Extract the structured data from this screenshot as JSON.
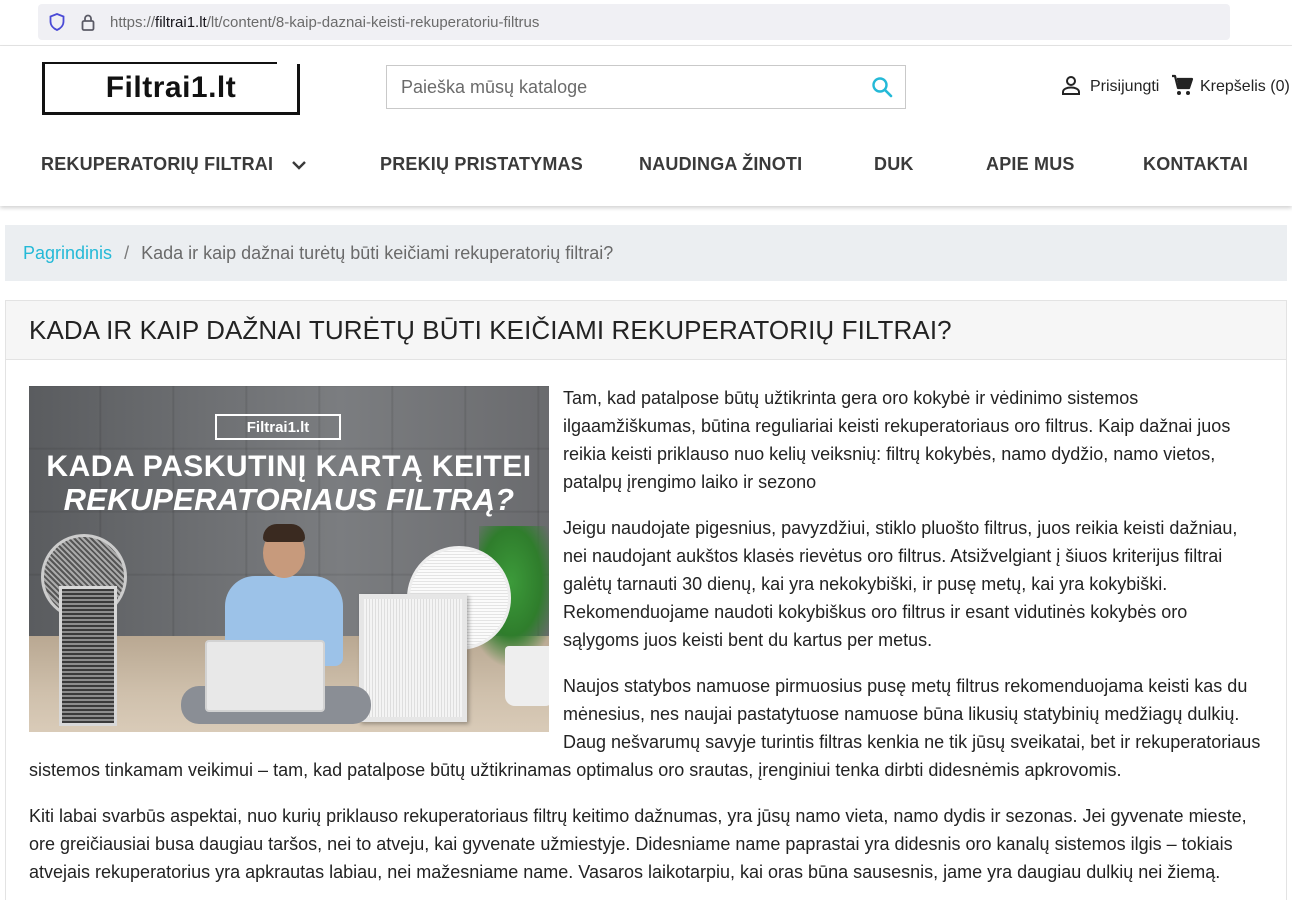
{
  "browser": {
    "url_prefix": "https://",
    "url_domain": "filtrai1.lt",
    "url_path": "/lt/content/8-kaip-daznai-keisti-rekuperatoriu-filtrus"
  },
  "header": {
    "logo_text": "Filtrai1.lt",
    "search_placeholder": "Paieška mūsų kataloge",
    "account_label": "Prisijungti",
    "cart_label": "Krepšelis",
    "cart_count": "(0)"
  },
  "nav": {
    "items": [
      {
        "label": "REKUPERATORIŲ FILTRAI",
        "has_dropdown": true
      },
      {
        "label": "PREKIŲ PRISTATYMAS"
      },
      {
        "label": "NAUDINGA ŽINOTI"
      },
      {
        "label": "DUK"
      },
      {
        "label": "APIE MUS"
      },
      {
        "label": "KONTAKTAI"
      }
    ]
  },
  "breadcrumb": {
    "home": "Pagrindinis",
    "separator": "/",
    "current": "Kada ir kaip dažnai turėtų būti keičiami rekuperatorių filtrai?"
  },
  "article": {
    "title": "KADA IR KAIP DAŽNAI TURĖTŲ BŪTI KEIČIAMI REKUPERATORIŲ FILTRAI?",
    "image": {
      "badge": "Filtrai1.lt",
      "line1": "KADA PASKUTINĮ KARTĄ KEITEI",
      "line2": "REKUPERATORIAUS FILTRĄ?"
    },
    "paragraphs": [
      "Tam, kad patalpose būtų užtikrinta gera oro kokybė ir vėdinimo sistemos ilgaamžiškumas, būtina reguliariai keisti rekuperatoriaus oro filtrus. Kaip dažnai juos reikia keisti priklauso nuo kelių veiksnių: filtrų kokybės, namo dydžio, namo vietos, patalpų įrengimo laiko ir sezono",
      "Jeigu naudojate pigesnius, pavyzdžiui, stiklo pluošto filtrus, juos reikia keisti dažniau, nei naudojant aukštos klasės rievėtus oro filtrus. Atsižvelgiant į šiuos kriterijus filtrai galėtų tarnauti 30 dienų, kai yra nekokybiški, ir pusę metų, kai yra kokybiški. Rekomenduojame naudoti kokybiškus oro filtrus ir esant vidutinės kokybės oro sąlygoms juos keisti bent du kartus per metus.",
      "Naujos statybos namuose pirmuosius pusę metų filtrus rekomenduojama keisti kas du mėnesius, nes naujai pastatytuose namuose būna likusių statybinių medžiagų dulkių. Daug nešvarumų savyje turintis filtras kenkia ne tik jūsų sveikatai, bet ir rekuperatoriaus sistemos tinkamam veikimui – tam, kad patalpose būtų užtikrinamas optimalus oro srautas, įrenginiui tenka dirbti didesnėmis apkrovomis.",
      "Kiti labai svarbūs aspektai, nuo kurių priklauso rekuperatoriaus filtrų keitimo dažnumas, yra jūsų namo vieta, namo dydis ir sezonas. Jei gyvenate mieste, ore greičiausiai busa daugiau taršos, nei to atveju, kai gyvenate užmiestyje. Didesniame name paprastai yra didesnis oro kanalų sistemos ilgis – tokiais atvejais rekuperatorius yra apkrautas labiau, nei mažesniame name. Vasaros laikotarpiu, kai oras būna sausesnis, jame yra daugiau dulkių nei žiemą."
    ]
  },
  "colors": {
    "accent": "#24b9d7",
    "breadcrumb_bg": "#ebeef1",
    "text": "#232323"
  }
}
